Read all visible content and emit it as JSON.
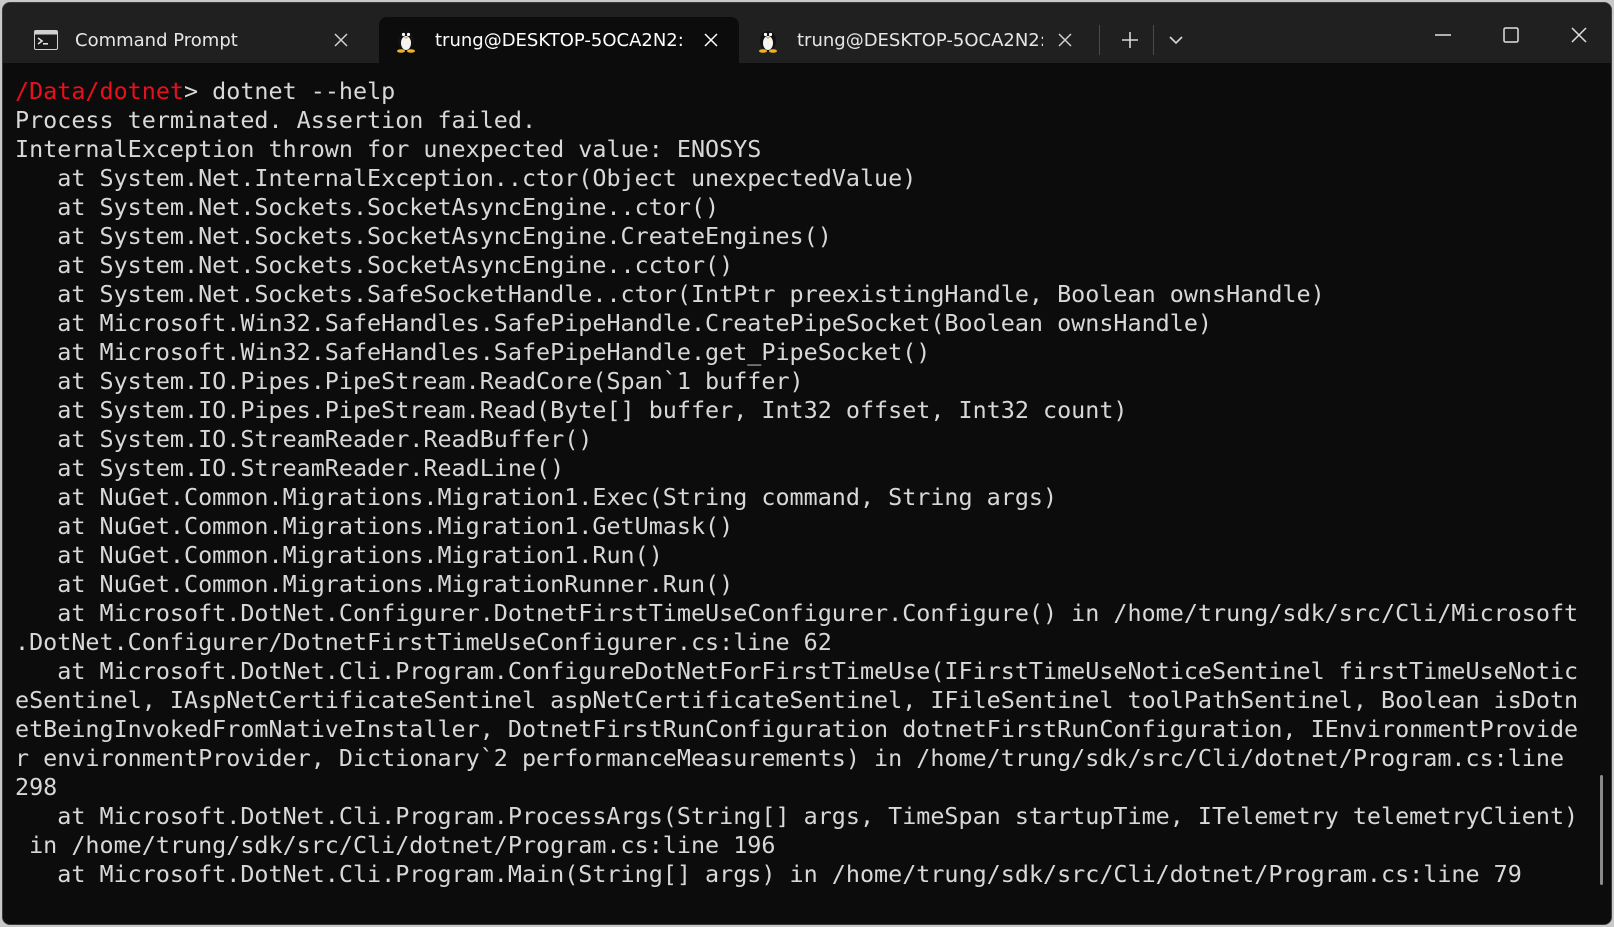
{
  "tabs": [
    {
      "title": "Command Prompt",
      "icon": "command-prompt-icon"
    },
    {
      "title": "trung@DESKTOP-5OCA2N2: ~",
      "icon": "linux-penguin-icon"
    },
    {
      "title": "trung@DESKTOP-5OCA2N2: ~",
      "icon": "linux-penguin-icon"
    }
  ],
  "active_tab_index": 1,
  "terminal": {
    "prompt_path": "/Data/dotnet",
    "prompt_symbol": ">",
    "command": " dotnet --help",
    "output_lines": [
      "Process terminated. Assertion failed.",
      "InternalException thrown for unexpected value: ENOSYS",
      "   at System.Net.InternalException..ctor(Object unexpectedValue)",
      "   at System.Net.Sockets.SocketAsyncEngine..ctor()",
      "   at System.Net.Sockets.SocketAsyncEngine.CreateEngines()",
      "   at System.Net.Sockets.SocketAsyncEngine..cctor()",
      "   at System.Net.Sockets.SafeSocketHandle..ctor(IntPtr preexistingHandle, Boolean ownsHandle)",
      "   at Microsoft.Win32.SafeHandles.SafePipeHandle.CreatePipeSocket(Boolean ownsHandle)",
      "   at Microsoft.Win32.SafeHandles.SafePipeHandle.get_PipeSocket()",
      "   at System.IO.Pipes.PipeStream.ReadCore(Span`1 buffer)",
      "   at System.IO.Pipes.PipeStream.Read(Byte[] buffer, Int32 offset, Int32 count)",
      "   at System.IO.StreamReader.ReadBuffer()",
      "   at System.IO.StreamReader.ReadLine()",
      "   at NuGet.Common.Migrations.Migration1.Exec(String command, String args)",
      "   at NuGet.Common.Migrations.Migration1.GetUmask()",
      "   at NuGet.Common.Migrations.Migration1.Run()",
      "   at NuGet.Common.Migrations.MigrationRunner.Run()",
      "   at Microsoft.DotNet.Configurer.DotnetFirstTimeUseConfigurer.Configure() in /home/trung/sdk/src/Cli/Microsoft",
      ".DotNet.Configurer/DotnetFirstTimeUseConfigurer.cs:line 62",
      "   at Microsoft.DotNet.Cli.Program.ConfigureDotNetForFirstTimeUse(IFirstTimeUseNoticeSentinel firstTimeUseNotic",
      "eSentinel, IAspNetCertificateSentinel aspNetCertificateSentinel, IFileSentinel toolPathSentinel, Boolean isDotn",
      "etBeingInvokedFromNativeInstaller, DotnetFirstRunConfiguration dotnetFirstRunConfiguration, IEnvironmentProvide",
      "r environmentProvider, Dictionary`2 performanceMeasurements) in /home/trung/sdk/src/Cli/dotnet/Program.cs:line",
      "298",
      "   at Microsoft.DotNet.Cli.Program.ProcessArgs(String[] args, TimeSpan startupTime, ITelemetry telemetryClient)",
      " in /home/trung/sdk/src/Cli/dotnet/Program.cs:line 196",
      "   at Microsoft.DotNet.Cli.Program.Main(String[] args) in /home/trung/sdk/src/Cli/dotnet/Program.cs:line 79"
    ]
  },
  "colors": {
    "titlebar_bg": "#202020",
    "terminal_bg": "#0c0c0c",
    "terminal_fg": "#d8d8d8",
    "prompt_path": "#e8101c"
  }
}
